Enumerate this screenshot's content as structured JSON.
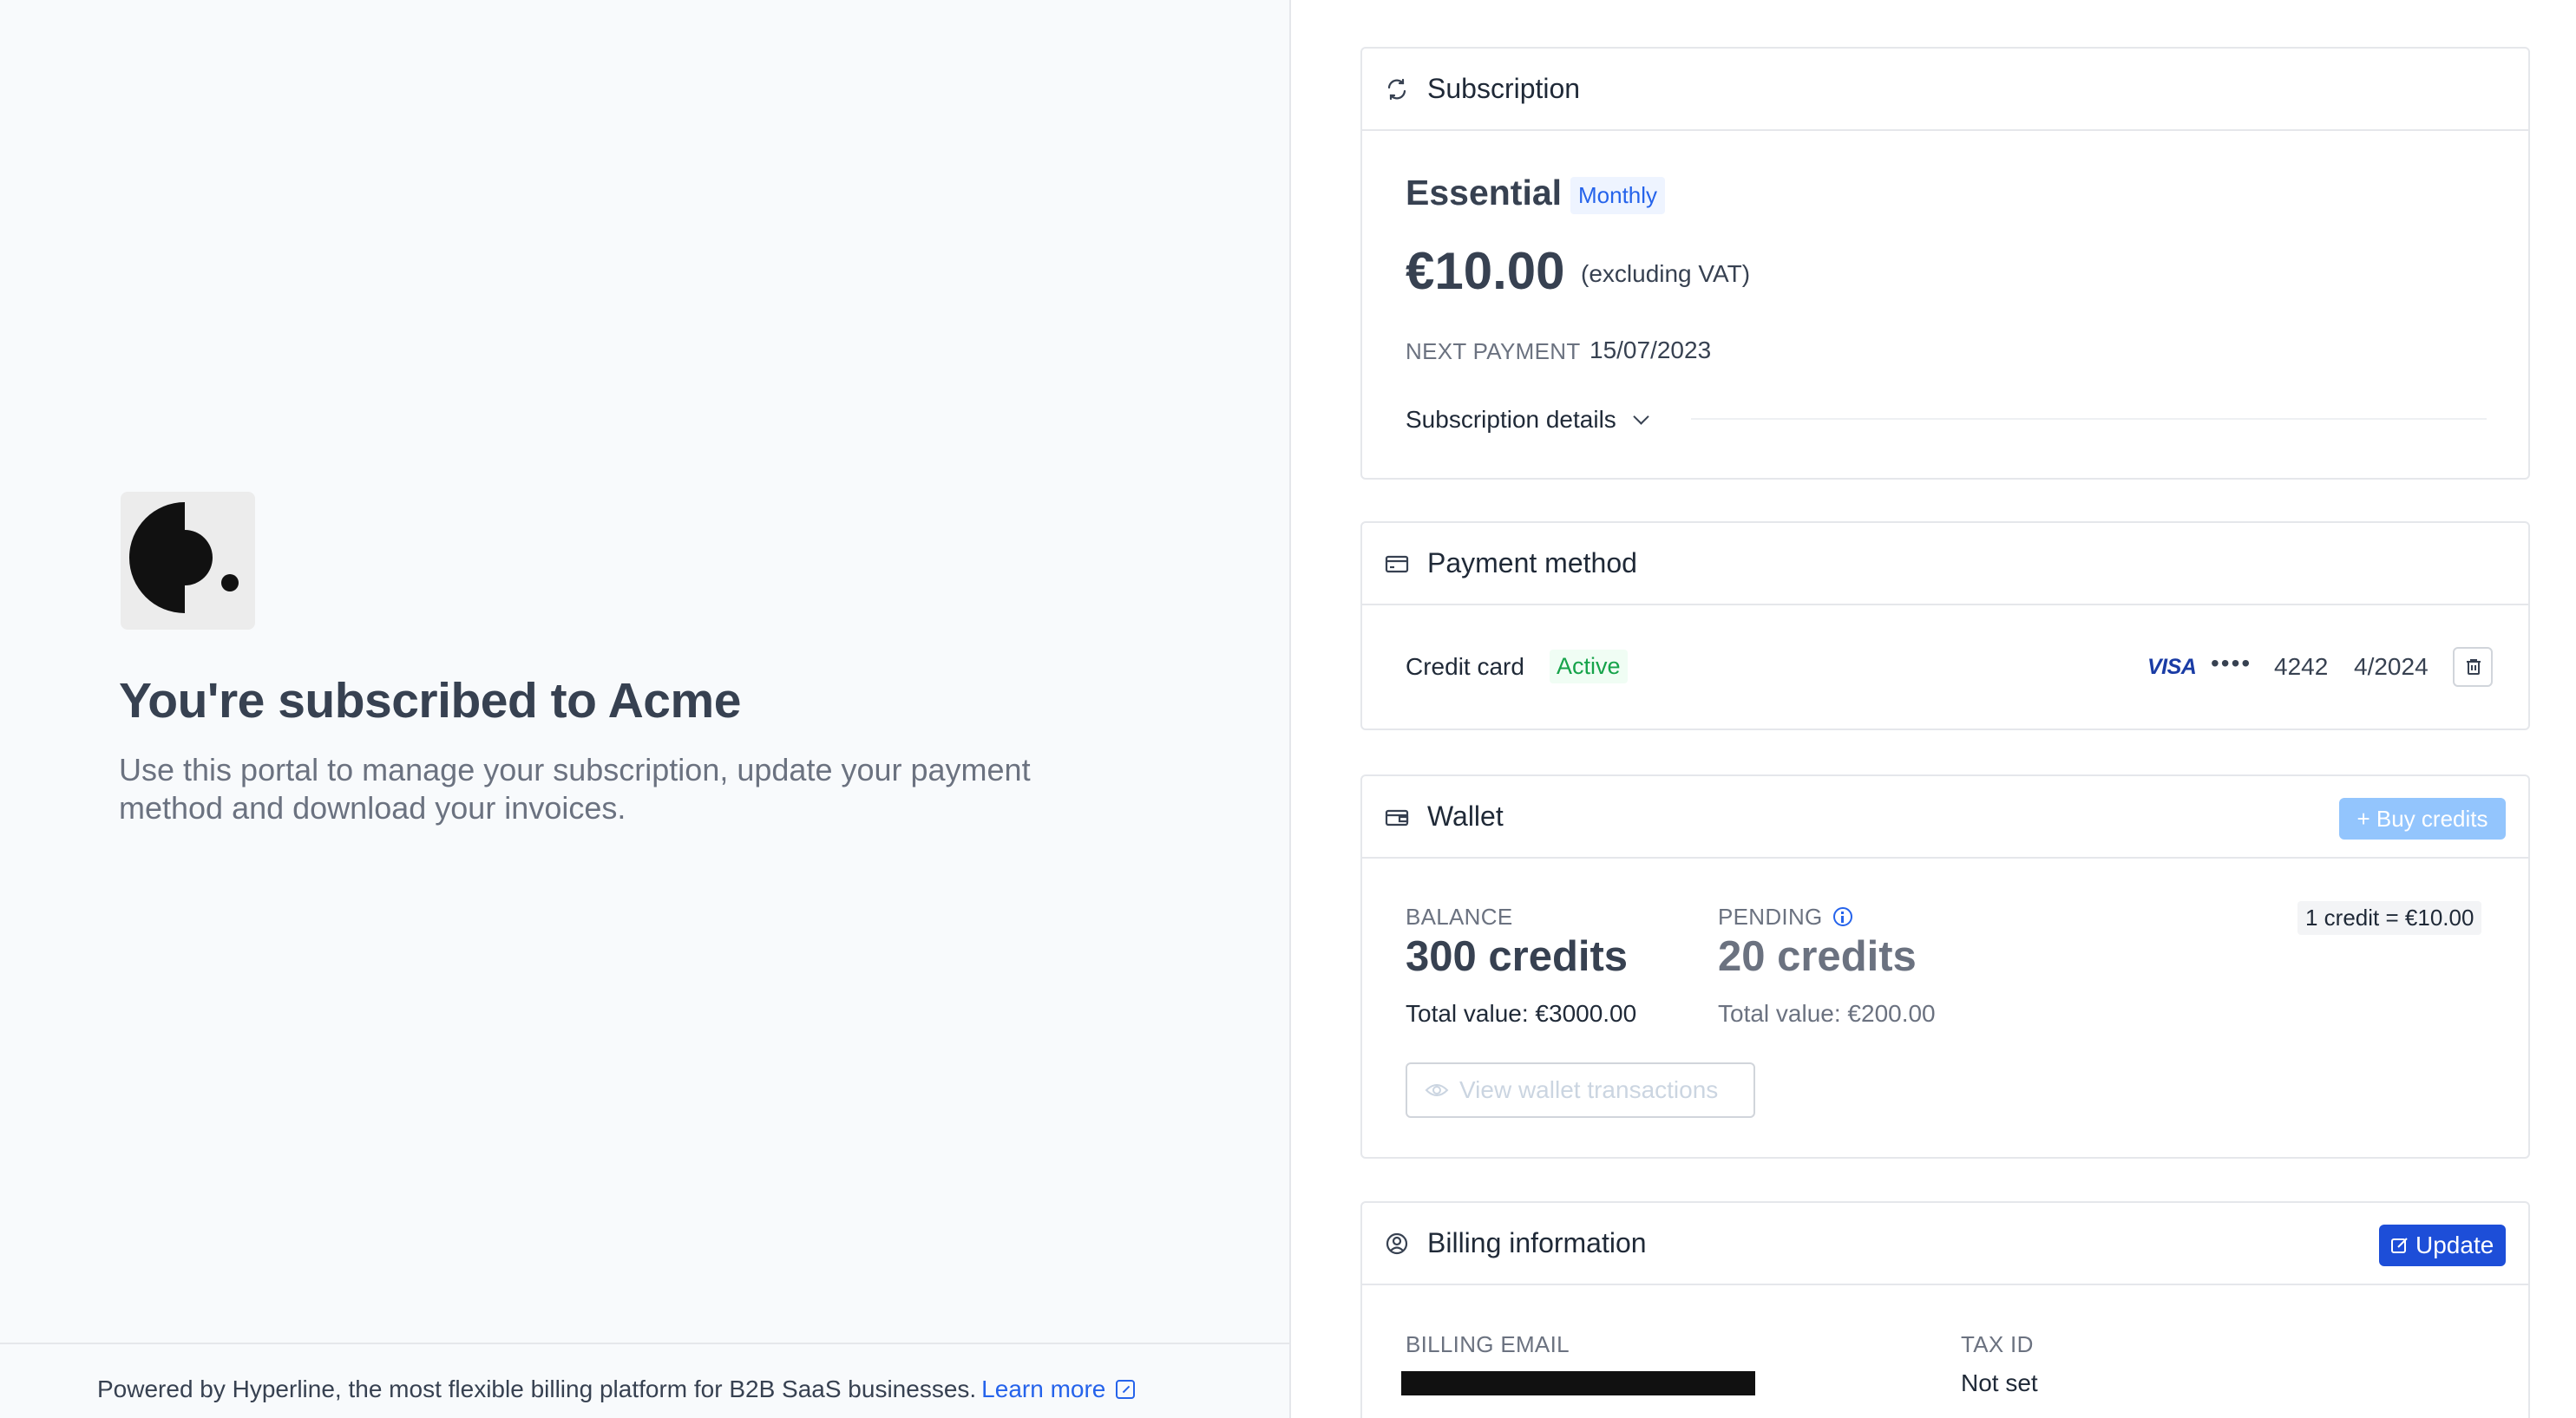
{
  "intro": {
    "logo_icon": "acme-logo-icon",
    "title": "You're subscribed to Acme",
    "subtitle": "Use this portal to manage your subscription, update your payment method and download your invoices."
  },
  "footer": {
    "text": "Powered by Hyperline, the most flexible billing platform for B2B SaaS businesses.",
    "link_label": "Learn more"
  },
  "subscription": {
    "header_title": "Subscription",
    "header_icon": "refresh-icon",
    "plan_name": "Essential",
    "billing_period": "Monthly",
    "price": "€10.00",
    "price_note": "(excluding VAT)",
    "next_payment_label": "NEXT PAYMENT",
    "next_payment_date": "15/07/2023",
    "details_toggle_label": "Subscription details"
  },
  "payment_method": {
    "header_title": "Payment method",
    "header_icon": "credit-card-icon",
    "method_label": "Credit card",
    "status": "Active",
    "brand": "VISA",
    "masked": "••••",
    "last4": "4242",
    "expiry": "4/2024"
  },
  "wallet": {
    "header_title": "Wallet",
    "header_icon": "wallet-icon",
    "buy_button_label": "+ Buy credits",
    "rate": "1 credit = €10.00",
    "balance_label": "BALANCE",
    "balance_value": "300 credits",
    "balance_total": "Total value: €3000.00",
    "pending_label": "PENDING",
    "pending_value": "20 credits",
    "pending_total": "Total value: €200.00",
    "view_transactions_label": "View wallet transactions"
  },
  "billing_info": {
    "header_title": "Billing information",
    "header_icon": "user-circle-icon",
    "update_button_label": "Update",
    "billing_email_label": "BILLING EMAIL",
    "tax_id_label": "TAX ID",
    "tax_id_value": "Not set"
  },
  "colors": {
    "accent": "#1d4ed8",
    "accent_light": "#93c5fd",
    "success": "#16a34a",
    "left_bg": "#f8fafc"
  }
}
